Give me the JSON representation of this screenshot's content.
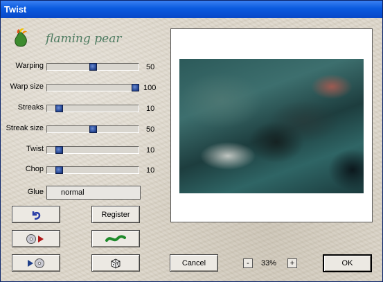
{
  "window": {
    "title": "Twist"
  },
  "logo": {
    "text": "flaming pear"
  },
  "sliders": [
    {
      "label": "Warping",
      "value": "50",
      "fraction": 0.5
    },
    {
      "label": "Warp size",
      "value": "100",
      "fraction": 1.0
    },
    {
      "label": "Streaks",
      "value": "10",
      "fraction": 0.1
    },
    {
      "label": "Streak size",
      "value": "50",
      "fraction": 0.5
    },
    {
      "label": "Twist",
      "value": "10",
      "fraction": 0.1
    },
    {
      "label": "Chop",
      "value": "10",
      "fraction": 0.1
    }
  ],
  "glue": {
    "label": "Glue",
    "value": "normal"
  },
  "buttons": {
    "register": "Register",
    "cancel": "Cancel",
    "ok": "OK"
  },
  "zoom": {
    "minus": "-",
    "value": "33%",
    "plus": "+"
  },
  "colors": {
    "titlebar": "#0a5adf",
    "accent": "#2a4c9a",
    "logo": "#4f7c62"
  },
  "icons": {
    "undo": "undo-arrow-icon",
    "save": "disc-save-icon",
    "load": "disc-load-icon",
    "random-wave": "wave-icon",
    "randomize": "dice-icon",
    "logo": "flaming-pear-icon"
  }
}
